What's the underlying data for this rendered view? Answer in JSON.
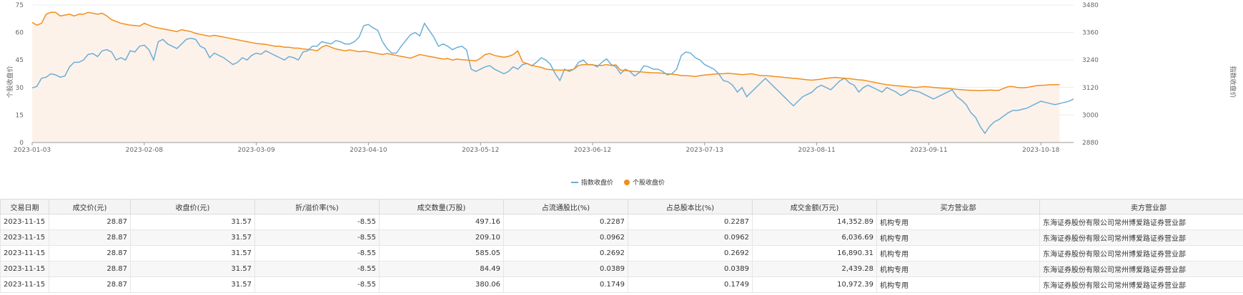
{
  "chart_data": {
    "type": "line",
    "ylabel_left": "个股收盘价",
    "ylabel_right": "指数收盘价",
    "left_axis": {
      "min": 0,
      "max": 75,
      "ticks": [
        0,
        15,
        30,
        45,
        60,
        75
      ]
    },
    "right_axis": {
      "min": 2880,
      "max": 3480,
      "ticks": [
        "2880",
        "3000",
        "3120",
        "3240",
        "3360",
        "3480"
      ]
    },
    "x_tick_labels": [
      "2023-01-03",
      "2023-02-08",
      "2023-03-09",
      "2023-04-10",
      "2023-05-12",
      "2023-06-12",
      "2023-07-13",
      "2023-08-11",
      "2023-09-11",
      "2023-10-18"
    ],
    "x_tick_index": [
      0,
      24,
      48,
      72,
      96,
      120,
      144,
      168,
      192,
      216
    ],
    "colors": {
      "index": "#6baed6",
      "stock": "#f28e1c",
      "area": "#fdf1e8",
      "grid": "#ececec"
    },
    "legend_position": "bottom-center",
    "series": [
      {
        "name": "指数收盘价",
        "axis": "right",
        "values": [
          3118,
          3125,
          3160,
          3165,
          3180,
          3175,
          3165,
          3170,
          3210,
          3230,
          3230,
          3240,
          3265,
          3268,
          3255,
          3280,
          3285,
          3275,
          3240,
          3250,
          3240,
          3280,
          3275,
          3300,
          3305,
          3285,
          3240,
          3320,
          3330,
          3310,
          3300,
          3290,
          3310,
          3330,
          3335,
          3330,
          3300,
          3290,
          3250,
          3270,
          3260,
          3250,
          3235,
          3220,
          3230,
          3250,
          3240,
          3260,
          3270,
          3265,
          3280,
          3270,
          3260,
          3250,
          3240,
          3255,
          3250,
          3240,
          3275,
          3280,
          3300,
          3300,
          3320,
          3315,
          3310,
          3325,
          3320,
          3310,
          3310,
          3320,
          3340,
          3390,
          3395,
          3380,
          3370,
          3320,
          3290,
          3270,
          3270,
          3300,
          3325,
          3350,
          3360,
          3345,
          3400,
          3370,
          3340,
          3300,
          3310,
          3300,
          3285,
          3295,
          3300,
          3285,
          3200,
          3190,
          3200,
          3210,
          3215,
          3200,
          3190,
          3180,
          3190,
          3210,
          3200,
          3220,
          3225,
          3215,
          3230,
          3250,
          3240,
          3220,
          3180,
          3150,
          3200,
          3190,
          3200,
          3230,
          3240,
          3220,
          3220,
          3210,
          3230,
          3245,
          3220,
          3210,
          3180,
          3200,
          3190,
          3170,
          3185,
          3215,
          3210,
          3200,
          3200,
          3190,
          3175,
          3180,
          3200,
          3260,
          3275,
          3270,
          3250,
          3240,
          3220,
          3210,
          3200,
          3180,
          3150,
          3145,
          3130,
          3100,
          3120,
          3080,
          3100,
          3120,
          3140,
          3160,
          3140,
          3120,
          3100,
          3080,
          3060,
          3040,
          3060,
          3080,
          3090,
          3100,
          3120,
          3130,
          3120,
          3110,
          3130,
          3150,
          3160,
          3140,
          3130,
          3100,
          3120,
          3130,
          3120,
          3110,
          3100,
          3120,
          3110,
          3100,
          3085,
          3095,
          3110,
          3105,
          3100,
          3090,
          3080,
          3070,
          3080,
          3090,
          3100,
          3110,
          3080,
          3065,
          3045,
          3010,
          2990,
          2950,
          2920,
          2950,
          2970,
          2980,
          2995,
          3010,
          3020,
          3020,
          3025,
          3030,
          3040,
          3050,
          3060,
          3055,
          3050,
          3045,
          3050,
          3055,
          3060,
          3070
        ]
      },
      {
        "name": "个股收盘价",
        "axis": "left",
        "values": [
          65.5,
          64,
          65,
          70,
          71,
          71,
          69,
          69.5,
          70,
          69,
          70,
          70,
          71,
          70.5,
          70,
          70.5,
          69,
          67,
          66,
          65,
          64.5,
          64,
          63.8,
          63.5,
          65,
          64,
          63,
          62.5,
          62,
          61.5,
          61,
          60.5,
          61.5,
          61,
          60.5,
          59.5,
          59,
          58.5,
          58,
          58.5,
          58,
          57.5,
          57,
          56.5,
          56,
          55.5,
          55,
          54.5,
          54,
          53.8,
          53.5,
          53,
          52.5,
          52.5,
          52,
          52,
          51.5,
          51.5,
          51,
          50.8,
          50.5,
          50,
          52,
          53,
          52,
          51,
          50.5,
          50,
          50.5,
          50,
          49.5,
          49.8,
          49.5,
          49,
          48.5,
          48,
          48.5,
          48,
          47.5,
          47,
          46.5,
          46,
          47,
          48,
          47.5,
          47,
          46.5,
          46,
          45.5,
          45.8,
          45,
          45.5,
          45.2,
          45,
          44.8,
          44.5,
          46,
          48,
          48.5,
          47.5,
          47,
          46.5,
          47,
          48,
          50,
          44,
          43,
          42,
          41.5,
          41,
          40,
          39.8,
          39.5,
          39.5,
          39.5,
          39.5,
          40,
          42,
          42.5,
          42.5,
          42.3,
          42,
          42,
          42.5,
          42,
          42.3,
          39.5,
          39.3,
          39,
          38.8,
          38.6,
          38.4,
          38.2,
          38,
          38,
          37.8,
          37.5,
          37.3,
          37,
          36.5,
          36.5,
          36.3,
          36,
          36.5,
          36.8,
          37,
          37.3,
          37.5,
          37.5,
          37.8,
          37.5,
          37.3,
          37,
          37.2,
          37.5,
          37,
          36.5,
          36.5,
          36.3,
          36,
          35.8,
          35.5,
          35.3,
          35,
          34.8,
          34.5,
          34.2,
          34,
          34.3,
          34.6,
          35,
          35.3,
          35.5,
          35.2,
          35,
          34.8,
          34.5,
          34.2,
          34,
          33.5,
          33,
          32.5,
          32,
          31.5,
          31.3,
          31,
          30.8,
          30.5,
          30.3,
          30,
          30.2,
          30.5,
          30.3,
          30,
          29.8,
          29.6,
          29.5,
          29.3,
          29,
          28.8,
          28.6,
          28.5,
          28.5,
          28.3,
          28.5,
          28.6,
          28.5,
          28.5,
          29.5,
          30.5,
          30.5,
          30,
          29.8,
          30,
          30.5,
          31,
          31.2,
          31.3,
          31.5,
          31.5,
          31.57
        ]
      }
    ]
  },
  "table": {
    "headers": [
      "交易日期",
      "成交价(元)",
      "收盘价(元)",
      "折/溢价率(%)",
      "成交数量(万股)",
      "占流通股比(%)",
      "占总股本比(%)",
      "成交金额(万元)",
      "买方营业部",
      "卖方营业部"
    ],
    "rows": [
      [
        "2023-11-15",
        "28.87",
        "31.57",
        "-8.55",
        "497.16",
        "0.2287",
        "0.2287",
        "14,352.89",
        "机构专用",
        "东海证券股份有限公司常州博爱路证券营业部"
      ],
      [
        "2023-11-15",
        "28.87",
        "31.57",
        "-8.55",
        "209.10",
        "0.0962",
        "0.0962",
        "6,036.69",
        "机构专用",
        "东海证券股份有限公司常州博爱路证券营业部"
      ],
      [
        "2023-11-15",
        "28.87",
        "31.57",
        "-8.55",
        "585.05",
        "0.2692",
        "0.2692",
        "16,890.31",
        "机构专用",
        "东海证券股份有限公司常州博爱路证券营业部"
      ],
      [
        "2023-11-15",
        "28.87",
        "31.57",
        "-8.55",
        "84.49",
        "0.0389",
        "0.0389",
        "2,439.28",
        "机构专用",
        "东海证券股份有限公司常州博爱路证券营业部"
      ],
      [
        "2023-11-15",
        "28.87",
        "31.57",
        "-8.55",
        "380.06",
        "0.1749",
        "0.1749",
        "10,972.39",
        "机构专用",
        "东海证券股份有限公司常州博爱路证券营业部"
      ]
    ]
  }
}
